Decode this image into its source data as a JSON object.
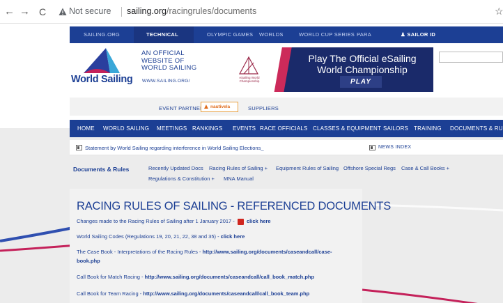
{
  "browser": {
    "not_secure": "Not secure",
    "url_host": "sailing.org",
    "url_path": "/racingrules/documents",
    "back_glyph": "←",
    "forward_glyph": "→",
    "reload_glyph": "C",
    "star_glyph": "☆"
  },
  "topbar": {
    "items": [
      "SAILING.ORG",
      "TECHNICAL",
      "OLYMPIC GAMES",
      "WORLDS",
      "WORLD CUP SERIES",
      "PARA"
    ],
    "active": "TECHNICAL",
    "sailor_id": "SAILOR ID",
    "sailor_icon": "person-icon"
  },
  "header": {
    "logo_text": "World Sailing",
    "official_lines": [
      "AN OFFICIAL",
      "WEBSITE OF",
      "WORLD SAILING"
    ],
    "www": "WWW.SAILING.ORG/"
  },
  "banner": {
    "logo_text": "eSailing World Championship",
    "line1": "Play The Official eSailing",
    "line2": "World Championship",
    "play": "PLAY"
  },
  "partners": {
    "event_partners": "EVENT PARTNERS",
    "nautivela": "nautivela",
    "suppliers": "SUPPLIERS"
  },
  "mainnav": {
    "items": [
      "HOME",
      "WORLD SAILING",
      "MEETINGS",
      "RANKINGS",
      "EVENTS",
      "RACE OFFICIALS",
      "CLASSES & EQUIPMENT",
      "SAILORS",
      "TRAINING",
      "DOCUMENTS & RULE"
    ]
  },
  "news": {
    "statement": "Statement by World Sailing regarding interference in World Sailing Elections_",
    "index": "NEWS INDEX"
  },
  "subnav": {
    "title": "Documents & Rules",
    "row1": [
      "Recently Updated Docs",
      "Racing Rules of Sailing +",
      "Equipment Rules of Sailing",
      "Offshore Special Regs",
      "Case & Call Books +"
    ],
    "row2": [
      "Regulations & Constitution +",
      "MNA Manual"
    ]
  },
  "content": {
    "title": "RACING RULES OF SAILING - REFERENCED DOCUMENTS",
    "line1_text": "Changes made to the Racing Rules of Sailing after 1 January 2017 -",
    "line1_link": "click here",
    "line2_text": "World Sailing Codes (Regulations 19, 20, 21, 22, 38 and 35) -",
    "line2_link": "click here",
    "line3_text": "The Case Book - Interpretations of the Racing Rules -",
    "line3_link_a": "http://www.sailing.org/documents/caseandcall/case-",
    "line3_link_b": "book.php",
    "line4_text": "Call Book for Match Racing -",
    "line4_link": "http://www.sailing.org/documents/caseandcall/call_book_match.php",
    "line5_text": "Call Book for Team Racing -",
    "line5_link": "http://www.sailing.org/documents/caseandcall/call_book_team.php"
  },
  "colors": {
    "brand_blue": "#1c3f94",
    "stripe_blue": "#2f4fb0",
    "stripe_magenta": "#c4215a",
    "page_grey": "#ececec"
  }
}
